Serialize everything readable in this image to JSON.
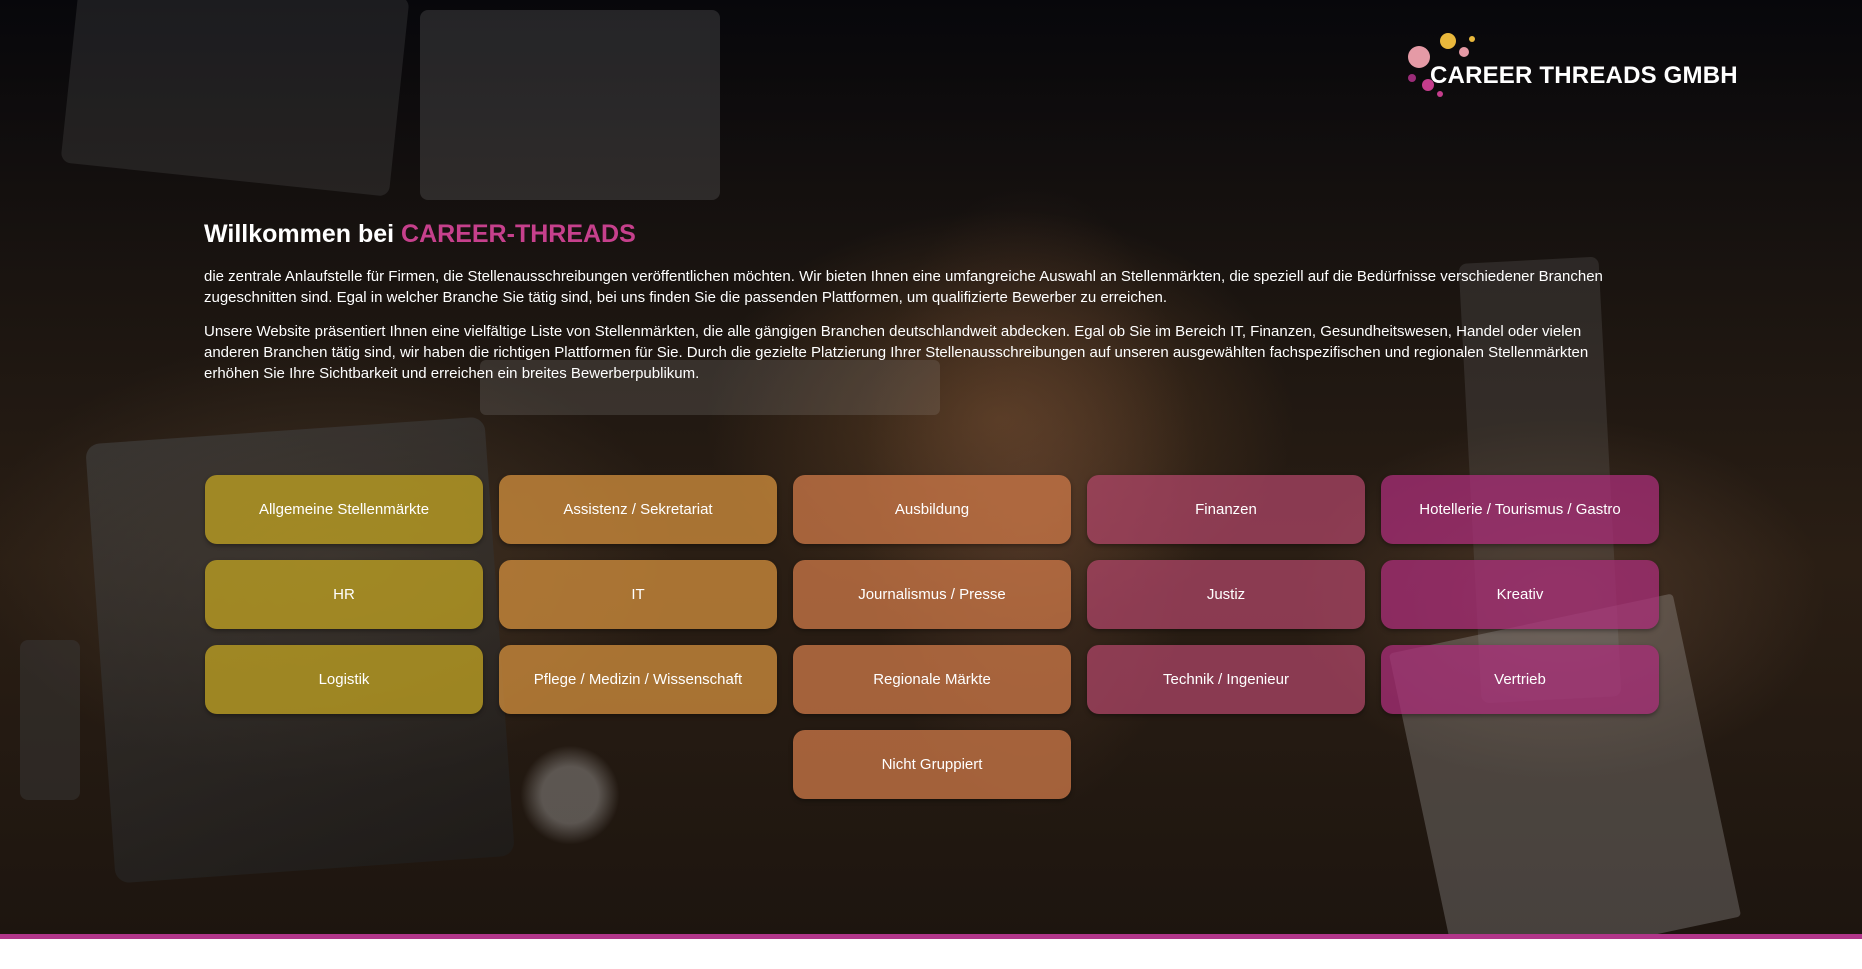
{
  "logo": {
    "text": "CAREER THREADS GMBH",
    "colors": [
      "#e59aa6",
      "#e9b83c",
      "#c53d8c",
      "#9b2c78"
    ]
  },
  "intro": {
    "heading_prefix": "Willkommen bei ",
    "heading_brand": "CAREER-THREADS",
    "paragraph1": "die zentrale Anlaufstelle für Firmen, die Stellenausschreibungen veröffentlichen möchten. Wir bieten Ihnen eine umfangreiche Auswahl an Stellenmärkten, die speziell auf die Bedürfnisse verschiedener Branchen zugeschnitten sind. Egal in welcher Branche Sie tätig sind, bei uns finden Sie die passenden Plattformen, um qualifizierte Bewerber zu erreichen.",
    "paragraph2": "Unsere Website präsentiert Ihnen eine vielfältige Liste von Stellenmärkten, die alle gängigen Branchen deutschlandweit abdecken. Egal ob Sie im Bereich IT, Finanzen, Gesundheitswesen, Handel oder vielen anderen Branchen tätig sind, wir haben die richtigen Plattformen für Sie. Durch die gezielte Platzierung Ihrer Stellenausschreibungen auf unseren ausgewählten fachspezifischen und regionalen Stellenmärkten erhöhen Sie Ihre Sichtbarkeit und erreichen ein breites Bewerberpublikum."
  },
  "categories": [
    "Allgemeine Stellenmärkte",
    "Assistenz / Sekretariat",
    "Ausbildung",
    "Finanzen",
    "Hotellerie / Tourismus / Gastro",
    "HR",
    "IT",
    "Journalismus / Presse",
    "Justiz",
    "Kreativ",
    "Logistik",
    "Pflege / Medizin / Wissenschaft",
    "Regionale Märkte",
    "Technik / Ingenieur",
    "Vertrieb",
    "Nicht Gruppiert"
  ],
  "colors": {
    "brand_accent": "#c6408c",
    "bottom_line": "#b1368a"
  }
}
